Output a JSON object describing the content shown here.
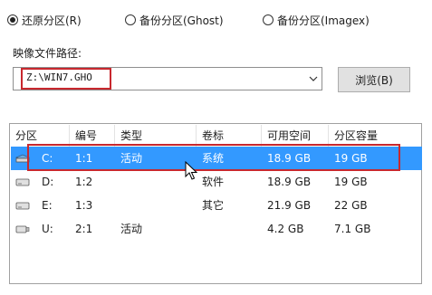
{
  "radios": [
    {
      "label": "还原分区(R)",
      "checked": true
    },
    {
      "label": "备份分区(Ghost)",
      "checked": false
    },
    {
      "label": "备份分区(Imagex)",
      "checked": false
    }
  ],
  "path": {
    "label": "映像文件路径:",
    "value": "Z:\\WIN7.GHO",
    "browse_label": "浏览(B)"
  },
  "table": {
    "headers": [
      "分区",
      "编号",
      "类型",
      "卷标",
      "可用空间",
      "分区容量"
    ],
    "rows": [
      {
        "drive": "C:",
        "num": "1:1",
        "type": "活动",
        "label": "系统",
        "free": "18.9 GB",
        "size": "19 GB",
        "selected": true,
        "icon": "system-drive-icon"
      },
      {
        "drive": "D:",
        "num": "1:2",
        "type": "",
        "label": "软件",
        "free": "18.9 GB",
        "size": "19 GB",
        "selected": false,
        "icon": "hard-drive-icon"
      },
      {
        "drive": "E:",
        "num": "1:3",
        "type": "",
        "label": "其它",
        "free": "21.9 GB",
        "size": "22 GB",
        "selected": false,
        "icon": "hard-drive-icon"
      },
      {
        "drive": "U:",
        "num": "2:1",
        "type": "活动",
        "label": "",
        "free": "4.2 GB",
        "size": "7.1 GB",
        "selected": false,
        "icon": "usb-drive-icon"
      }
    ]
  },
  "colors": {
    "selection": "#3399ff",
    "highlight_outline": "#c8282e"
  }
}
